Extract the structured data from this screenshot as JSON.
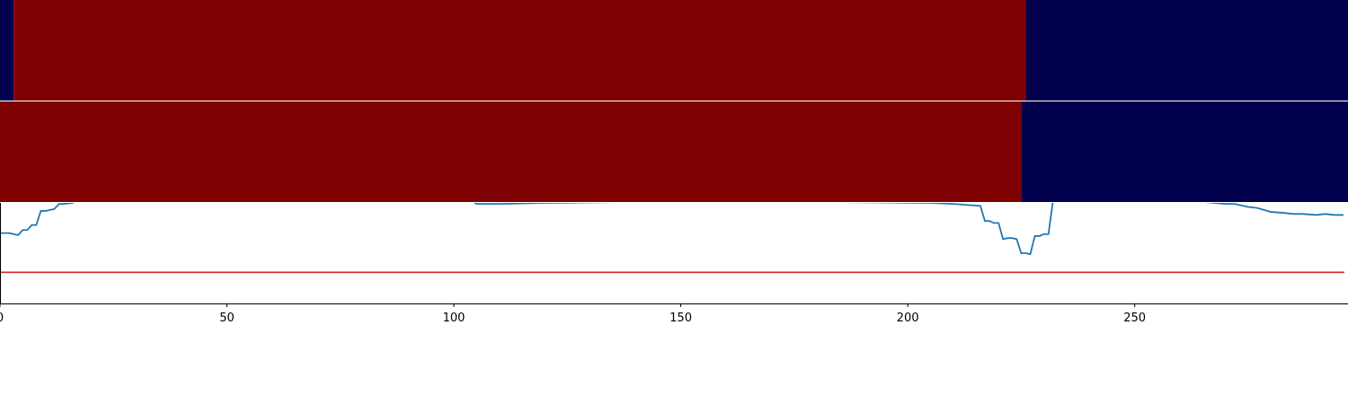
{
  "colors": {
    "state_high": "#7f0000",
    "state_low": "#00004c",
    "signal_line": "#1f77b4",
    "threshold_line": "#d62728",
    "axis": "#000000",
    "band_separator": "#ffffff"
  },
  "chart_data": {
    "type": "line",
    "title": "",
    "xlabel": "",
    "ylabel": "",
    "xlim": [
      0,
      297
    ],
    "ylim": [
      0.0,
      1.0
    ],
    "x_ticks": [
      0,
      50,
      100,
      150,
      200,
      250
    ],
    "x_tick_labels": [
      "0",
      "50",
      "100",
      "150",
      "200",
      "250"
    ],
    "grid": false,
    "state_bands": [
      {
        "segments": [
          {
            "state": "low",
            "start": 0,
            "end": 3
          },
          {
            "state": "high",
            "start": 3,
            "end": 226
          },
          {
            "state": "low",
            "start": 226,
            "end": 297
          }
        ]
      },
      {
        "segments": [
          {
            "state": "high",
            "start": 0,
            "end": 225
          },
          {
            "state": "low",
            "start": 225,
            "end": 297
          }
        ]
      }
    ],
    "threshold": 0.31,
    "series": [
      {
        "points": [
          [
            0,
            0.7
          ],
          [
            2,
            0.7
          ],
          [
            4,
            0.68
          ],
          [
            5,
            0.73
          ],
          [
            6,
            0.73
          ],
          [
            7,
            0.78
          ],
          [
            8,
            0.78
          ],
          [
            9,
            0.92
          ],
          [
            10,
            0.92
          ],
          [
            12,
            0.94
          ],
          [
            13,
            0.99
          ],
          [
            14,
            0.99
          ],
          [
            16,
            1.0
          ],
          [
            17,
            1.02
          ],
          [
            20,
            1.02
          ],
          [
            40,
            1.02
          ],
          [
            80,
            1.02
          ],
          [
            104,
            1.02
          ],
          [
            105,
            0.99
          ],
          [
            110,
            0.99
          ],
          [
            120,
            1.0
          ],
          [
            140,
            1.01
          ],
          [
            180,
            1.01
          ],
          [
            205,
            1.0
          ],
          [
            210,
            0.99
          ],
          [
            213,
            0.98
          ],
          [
            216,
            0.97
          ],
          [
            217,
            0.82
          ],
          [
            218,
            0.82
          ],
          [
            219,
            0.8
          ],
          [
            220,
            0.8
          ],
          [
            221,
            0.64
          ],
          [
            222,
            0.65
          ],
          [
            223,
            0.65
          ],
          [
            224,
            0.64
          ],
          [
            225,
            0.5
          ],
          [
            226,
            0.5
          ],
          [
            227,
            0.49
          ],
          [
            228,
            0.67
          ],
          [
            229,
            0.67
          ],
          [
            230,
            0.69
          ],
          [
            231,
            0.69
          ],
          [
            232,
            1.02
          ],
          [
            235,
            1.02
          ],
          [
            250,
            1.02
          ],
          [
            260,
            1.01
          ],
          [
            265,
            1.01
          ],
          [
            270,
            0.99
          ],
          [
            272,
            0.99
          ],
          [
            275,
            0.96
          ],
          [
            277,
            0.95
          ],
          [
            280,
            0.91
          ],
          [
            283,
            0.9
          ],
          [
            285,
            0.89
          ],
          [
            287,
            0.89
          ],
          [
            290,
            0.88
          ],
          [
            292,
            0.89
          ],
          [
            294,
            0.88
          ],
          [
            296,
            0.88
          ]
        ]
      }
    ]
  }
}
